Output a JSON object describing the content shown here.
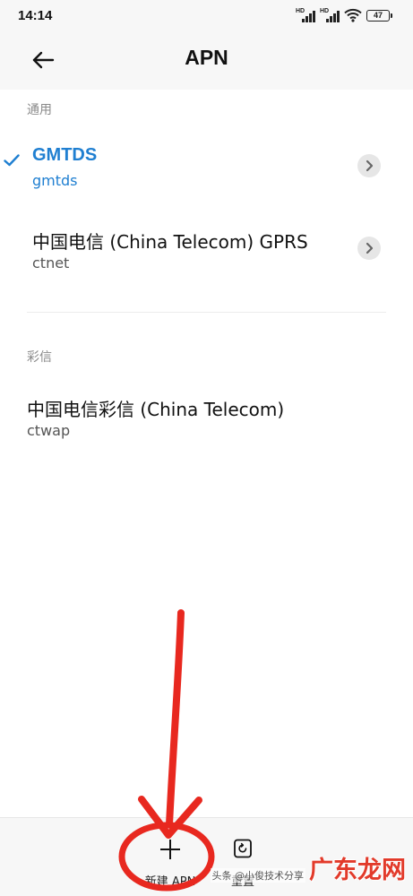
{
  "status_bar": {
    "time": "14:14",
    "signal_1_label": "HD",
    "signal_2_label": "HD",
    "battery": "47",
    "icons": [
      "signal-icon",
      "signal-icon",
      "wifi-icon",
      "battery-icon"
    ]
  },
  "header": {
    "title": "APN",
    "back_icon": "arrow-left-icon"
  },
  "sections": {
    "general": {
      "header": "通用",
      "items": [
        {
          "name": "GMTDS",
          "apn": "gmtds",
          "selected": true
        },
        {
          "name": "中国电信 (China Telecom) GPRS",
          "apn": "ctnet",
          "selected": false
        }
      ]
    },
    "mms": {
      "header": "彩信",
      "items": [
        {
          "name": "中国电信彩信 (China Telecom)",
          "apn": "ctwap",
          "selected": false
        }
      ]
    }
  },
  "bottom_bar": {
    "new_apn_label": "新建 APN",
    "reset_label": "重置"
  },
  "watermark": {
    "small": "头条 @小俊技术分享",
    "big": "广东龙网"
  },
  "colors": {
    "accent": "#1f7fd1",
    "annotation": "#e8281f",
    "bar_background": "#f7f7f7"
  }
}
